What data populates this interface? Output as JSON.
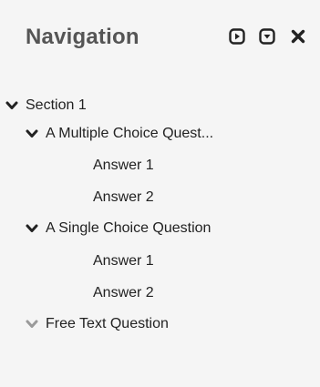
{
  "header": {
    "title": "Navigation",
    "play_icon": "play-square-icon",
    "collapse_icon": "caret-down-square-icon",
    "close_icon": "close-icon"
  },
  "tree": {
    "section": {
      "label": "Section 1",
      "expanded": true
    },
    "questions": [
      {
        "label": "A Multiple Choice Quest...",
        "expanded": true,
        "answers": [
          "Answer 1",
          "Answer 2"
        ]
      },
      {
        "label": "A Single Choice Question",
        "expanded": true,
        "answers": [
          "Answer 1",
          "Answer 2"
        ]
      },
      {
        "label": "Free Text Question",
        "expanded": false,
        "answers": []
      }
    ]
  },
  "colors": {
    "background": "#f5f5f5",
    "title": "#555555",
    "text": "#222222",
    "chevron_active": "#222222",
    "chevron_inactive": "#9a9a9a"
  }
}
